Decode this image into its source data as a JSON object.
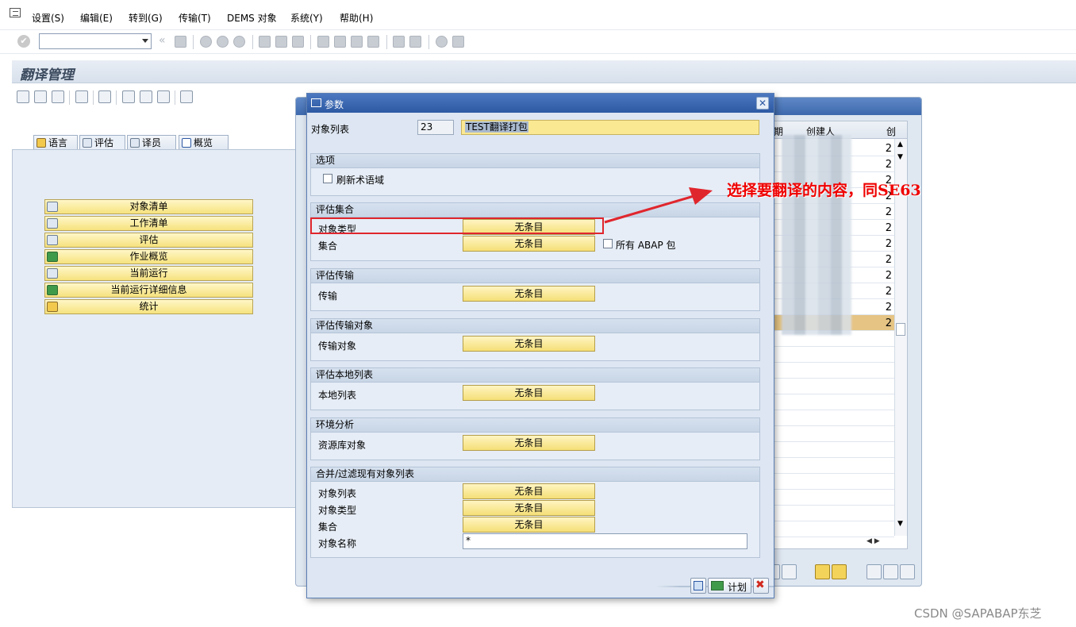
{
  "menu": {
    "items": [
      "设置(S)",
      "编辑(E)",
      "转到(G)",
      "传输(T)",
      "DEMS 对象",
      "系统(Y)",
      "帮助(H)"
    ]
  },
  "toolbar": {
    "command_field_value": ""
  },
  "screen": {
    "title": "翻译管理",
    "tabs": [
      "语言",
      "评估",
      "译员",
      "概览"
    ],
    "active_tab": "评估",
    "buttons": [
      "对象清单",
      "工作清单",
      "评估",
      "作业概览",
      "当前运行",
      "当前运行详细信息",
      "统计"
    ]
  },
  "background_table": {
    "headers": [
      "日期",
      "创建人",
      "创"
    ],
    "row_values": [
      "2",
      "2",
      "2",
      "2",
      "2",
      "2",
      "2",
      "2",
      "2",
      "2",
      "2",
      "2"
    ],
    "selected_row_index": 11
  },
  "dialog": {
    "title": "参数",
    "object_list_label": "对象列表",
    "object_list_number": "23",
    "object_list_name": "TEST翻译打包",
    "groups": {
      "options": {
        "title": "选项",
        "refresh_checkbox_label": "刷新术语域"
      },
      "eval_set": {
        "title": "评估集合",
        "object_type_label": "对象类型",
        "object_type_value": "无条目",
        "set_label": "集合",
        "set_value": "无条目",
        "all_abap_label": "所有 ABAP 包"
      },
      "eval_transport": {
        "title": "评估传输",
        "transport_label": "传输",
        "transport_value": "无条目"
      },
      "eval_transport_objects": {
        "title": "评估传输对象",
        "transport_objects_label": "传输对象",
        "transport_objects_value": "无条目"
      },
      "eval_local_list": {
        "title": "评估本地列表",
        "local_list_label": "本地列表",
        "local_list_value": "无条目"
      },
      "env_analysis": {
        "title": "环境分析",
        "repo_objects_label": "资源库对象",
        "repo_objects_value": "无条目"
      },
      "merge_filter": {
        "title": "合并/过滤现有对象列表",
        "object_list_label": "对象列表",
        "object_list_value": "无条目",
        "object_type_label": "对象类型",
        "object_type_value": "无条目",
        "set_label": "集合",
        "set_value": "无条目",
        "object_name_label": "对象名称",
        "object_name_value": "*"
      }
    },
    "footer": {
      "plan_label": "计划"
    }
  },
  "annotation": {
    "text": "选择要翻译的内容，同SE63",
    "color": "#ef0000"
  },
  "watermark": "CSDN @SAPABAP东芝"
}
